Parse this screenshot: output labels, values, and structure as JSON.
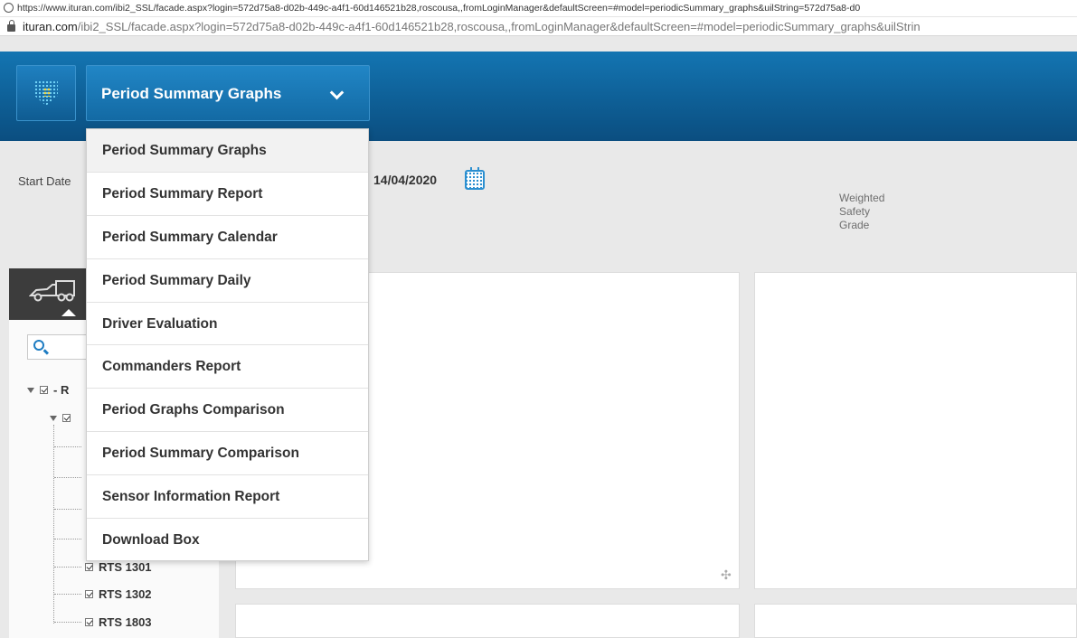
{
  "browser": {
    "url_full": "https://www.ituran.com/ibi2_SSL/facade.aspx?login=572d75a8-d02b-449c-a4f1-60d146521b28,roscousa,,fromLoginManager&defaultScreen=#model=periodicSummary_graphs&uilString=572d75a8-d0",
    "url_domain": "ituran.com",
    "url_path": "/ibi2_SSL/facade.aspx?login=572d75a8-d02b-449c-a4f1-60d146521b28,roscousa,,fromLoginManager&defaultScreen=#model=periodicSummary_graphs&uilStrin"
  },
  "header": {
    "module_title": "Period Summary Graphs"
  },
  "menu": {
    "items": [
      {
        "label": "Period Summary Graphs"
      },
      {
        "label": "Period Summary Report"
      },
      {
        "label": "Period Summary Calendar"
      },
      {
        "label": "Period Summary Daily"
      },
      {
        "label": "Driver Evaluation"
      },
      {
        "label": "Commanders Report"
      },
      {
        "label": "Period Graphs Comparison"
      },
      {
        "label": "Period Summary Comparison"
      },
      {
        "label": "Sensor Information Report"
      },
      {
        "label": "Download Box"
      }
    ]
  },
  "filters": {
    "start_date_label": "Start Date",
    "end_date_value": "14/04/2020",
    "weighted_line1": "Weighted",
    "weighted_line2": "Safety",
    "weighted_line3": "Grade"
  },
  "tree": {
    "root_label": "- R",
    "items": [
      {
        "label": "RTS 1301"
      },
      {
        "label": "RTS 1302"
      },
      {
        "label": "RTS 1803"
      }
    ]
  },
  "colors": {
    "header_blue": "#0e5f96",
    "accent_blue": "#1e7cc2"
  }
}
